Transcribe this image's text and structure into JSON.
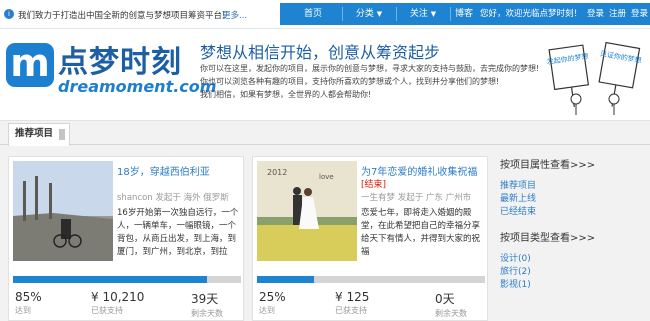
{
  "topbar": {
    "notice": "我们致力于打造出中国全新的创意与梦想项目筹资平台!",
    "more": "更多..."
  },
  "nav": {
    "items": [
      "首页",
      "分类",
      "关注",
      "博客"
    ],
    "caret": "▼",
    "welcome": "您好，欢迎光临点梦时刻！",
    "login": "登录",
    "register": "注册",
    "logout": "登录"
  },
  "banner": {
    "logo_m": "m",
    "logo_cn": "点梦时刻",
    "logo_en": "dreamoment.com",
    "slogan": "梦想从相信开始，创意从筹资起步",
    "desc": [
      "你可以在这里，发起你的项目，展示你的创意与梦想，寻求大家的支持与鼓励，去完成你的梦想!",
      "你也可以浏览各种有趣的项目，支持你所喜欢的梦想或个人，找到并分享他们的梦想!",
      "我们相信，如果有梦想，全世界的人都会帮助你!"
    ],
    "mascot_left": "发起你的梦想",
    "mascot_right": "见证你的梦想"
  },
  "tabs": {
    "active": "推荐项目"
  },
  "projects": [
    {
      "title": "18岁，穿越西伯利亚",
      "status": "",
      "meta": "shancon 发起于  海外  俄罗斯",
      "body": [
        "16岁开始第一次独自远行，一个",
        "人，一辆单车，一幅眼镜，一个",
        "背包，从商丘出发，到上海，到",
        "厦门，到广州，到北京，到拉"
      ],
      "progress": 85,
      "pct": "85%",
      "pct_label": "达到",
      "amount": "¥ 10,210",
      "amount_label": "已获支持",
      "days": "39天",
      "days_label": "剩余天数"
    },
    {
      "title": "为7年恋爱的婚礼收集祝福",
      "status": "[结束]",
      "meta": "一生有梦 发起于  广东  广州市",
      "body": [
        "恋爱七年，即将走入婚姻的殿",
        "堂，在此希望把自己的幸福分享",
        "给天下有情人，并得到大家的祝",
        "福"
      ],
      "progress": 25,
      "pct": "25%",
      "pct_label": "达到",
      "amount": "¥ 125",
      "amount_label": "已获支持",
      "days": "0天",
      "days_label": "剩余天数"
    }
  ],
  "sidebar": {
    "attr_title": "按项目属性查看>>>",
    "attr_links": [
      "推荐项目",
      "最新上线",
      "已经结束"
    ],
    "type_title": "按项目类型查看>>>",
    "type_links": [
      "设计(0)",
      "旅行(2)",
      "影视(1)"
    ]
  },
  "colors": {
    "brand": "#1e84d2",
    "link": "#2a7dc9",
    "ended": "#d81e06"
  }
}
